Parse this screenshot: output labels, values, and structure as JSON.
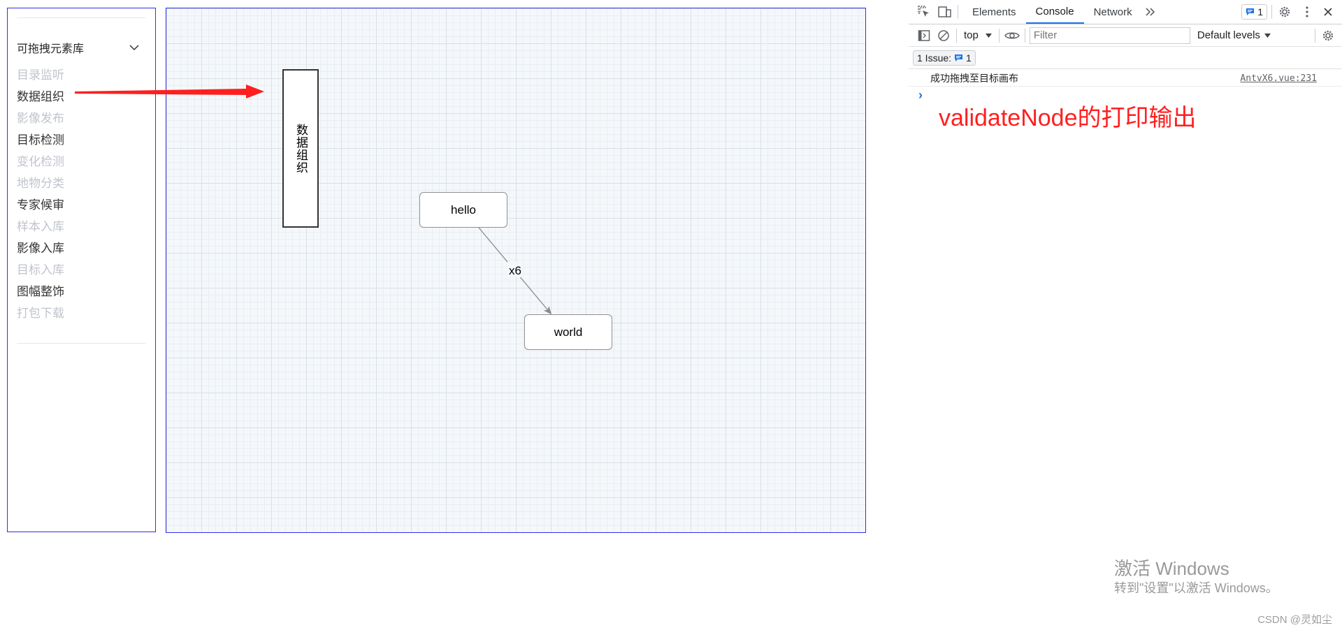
{
  "stencil": {
    "group_title": "可拖拽元素库",
    "items": [
      {
        "label": "目录监听",
        "enabled": false
      },
      {
        "label": "数据组织",
        "enabled": true
      },
      {
        "label": "影像发布",
        "enabled": false
      },
      {
        "label": "目标检测",
        "enabled": true
      },
      {
        "label": "变化检测",
        "enabled": false
      },
      {
        "label": "地物分类",
        "enabled": false
      },
      {
        "label": "专家候审",
        "enabled": true
      },
      {
        "label": "样本入库",
        "enabled": false
      },
      {
        "label": "影像入库",
        "enabled": true
      },
      {
        "label": "目标入库",
        "enabled": false
      },
      {
        "label": "图幅整饰",
        "enabled": true
      },
      {
        "label": "打包下载",
        "enabled": false
      }
    ]
  },
  "canvas": {
    "dragged_node_label": "数据组织",
    "node_hello": "hello",
    "node_world": "world",
    "edge_label": "x6"
  },
  "devtools": {
    "tabs": [
      "Elements",
      "Console",
      "Network"
    ],
    "active_tab": "Console",
    "issue_badge_count": "1",
    "context": "top",
    "filter_placeholder": "Filter",
    "levels": "Default levels",
    "issues_label": "1 Issue:",
    "issues_count": "1",
    "log_message": "成功拖拽至目标画布",
    "log_source": "AntvX6.vue:231",
    "prompt": "›"
  },
  "annotation": "validateNode的打印输出",
  "os_overlay": {
    "line1": "激活 Windows",
    "line2": "转到\"设置\"以激活 Windows。"
  },
  "watermark": "CSDN @灵如尘",
  "colors": {
    "panel_border": "#2e2ee6",
    "arrow": "#ff1f1f",
    "annotation": "#ff1f1f",
    "devtools_accent": "#1a73e8"
  }
}
